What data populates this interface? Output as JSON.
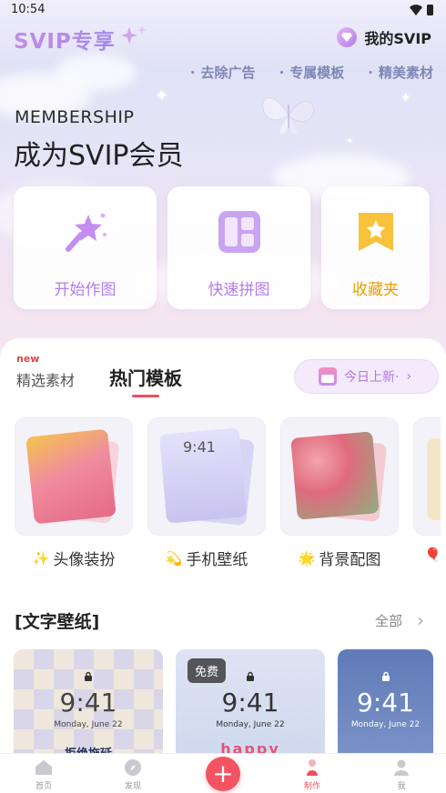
{
  "status_bar": {
    "time": "10:54"
  },
  "header": {
    "brand": "SVIP专享",
    "my_svip": "我的SVIP"
  },
  "perks": [
    "去除广告",
    "专属模板",
    "精美素材"
  ],
  "hero": {
    "eyebrow": "MEMBERSHIP",
    "title": "成为SVIP会员"
  },
  "actions": [
    {
      "label": "开始作图",
      "icon": "magic-wand-icon"
    },
    {
      "label": "快速拼图",
      "icon": "collage-icon"
    },
    {
      "label": "收藏夹",
      "icon": "favorites-star-icon"
    }
  ],
  "tabs": {
    "new_badge": "new",
    "items": [
      "精选素材",
      "热门模板"
    ],
    "active": "热门模板",
    "today_button": "今日上新·"
  },
  "categories": [
    {
      "emoji": "✨",
      "label": "头像装扮"
    },
    {
      "emoji": "💫",
      "label": "手机壁纸"
    },
    {
      "emoji": "🌟",
      "label": "背景配图"
    },
    {
      "emoji": "🎈",
      "label": ""
    }
  ],
  "wallpaper_section": {
    "title": "[文字壁纸]",
    "all_link": "全部",
    "free_badge": "免费",
    "cards": [
      {
        "time": "9:41",
        "date": "Monday, June 22",
        "caption": "拒绝拖延"
      },
      {
        "time": "9:41",
        "date": "Monday, June 22",
        "caption": "happy"
      },
      {
        "time": "9:41",
        "date": "Monday, June 22",
        "caption": ""
      }
    ]
  },
  "bottom_nav": {
    "items": [
      "首页",
      "发现",
      "制作",
      "我"
    ],
    "active": "制作",
    "fab": "+"
  },
  "colors": {
    "accent_red": "#ee4f5e",
    "svip_purple": "#b17fe6",
    "favorites_yellow": "#e9a000"
  }
}
